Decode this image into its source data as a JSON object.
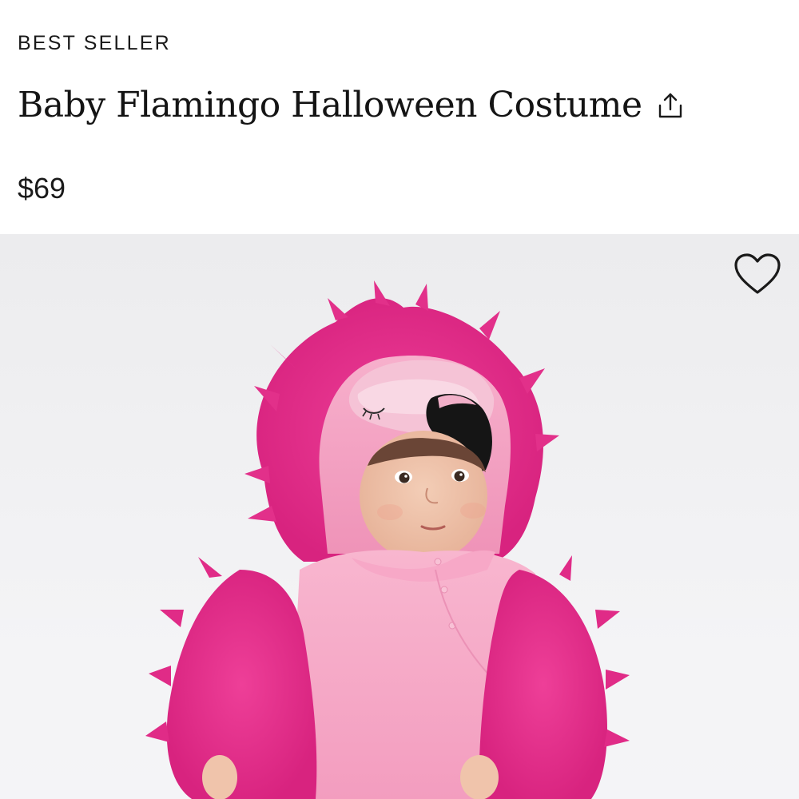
{
  "product": {
    "badge": "BEST SELLER",
    "title": "Baby Flamingo Halloween Costume",
    "price": "$69"
  },
  "icons": {
    "share": "share-icon",
    "favorite": "heart-icon"
  },
  "image": {
    "subject": "baby in pink flamingo costume"
  },
  "colors": {
    "text": "#1a1a1a",
    "fur": "#e8358f",
    "fleece": "#f6a9c8",
    "beak": "#141414",
    "background": "#efeff1"
  }
}
